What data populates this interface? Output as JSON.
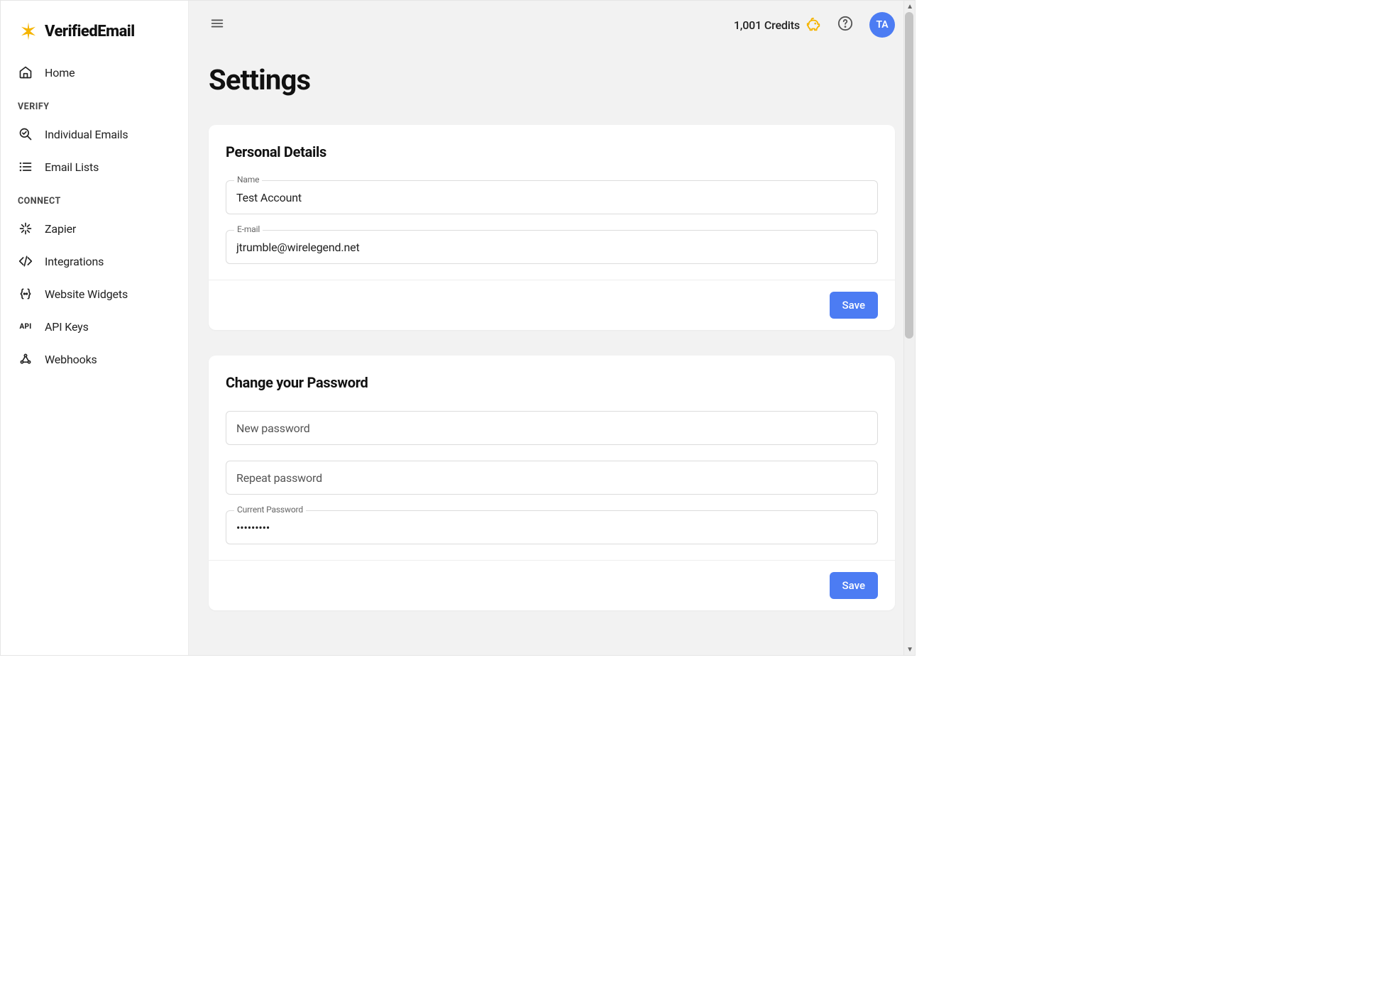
{
  "brand": {
    "name": "VerifiedEmail"
  },
  "sidebar": {
    "home_label": "Home",
    "section_verify": "VERIFY",
    "section_connect": "CONNECT",
    "items": {
      "individual_emails": "Individual Emails",
      "email_lists": "Email Lists",
      "zapier": "Zapier",
      "integrations": "Integrations",
      "website_widgets": "Website Widgets",
      "api_keys": "API Keys",
      "webhooks": "Webhooks"
    }
  },
  "topbar": {
    "credits_text": "1,001 Credits",
    "avatar_initials": "TA"
  },
  "page": {
    "title": "Settings"
  },
  "personal": {
    "heading": "Personal Details",
    "name_label": "Name",
    "name_value": "Test Account",
    "email_label": "E-mail",
    "email_value": "jtrumble@wirelegend.net",
    "save_label": "Save"
  },
  "password": {
    "heading": "Change your Password",
    "new_placeholder": "New password",
    "repeat_placeholder": "Repeat password",
    "current_label": "Current Password",
    "current_value": "•••••••••",
    "save_label": "Save"
  }
}
